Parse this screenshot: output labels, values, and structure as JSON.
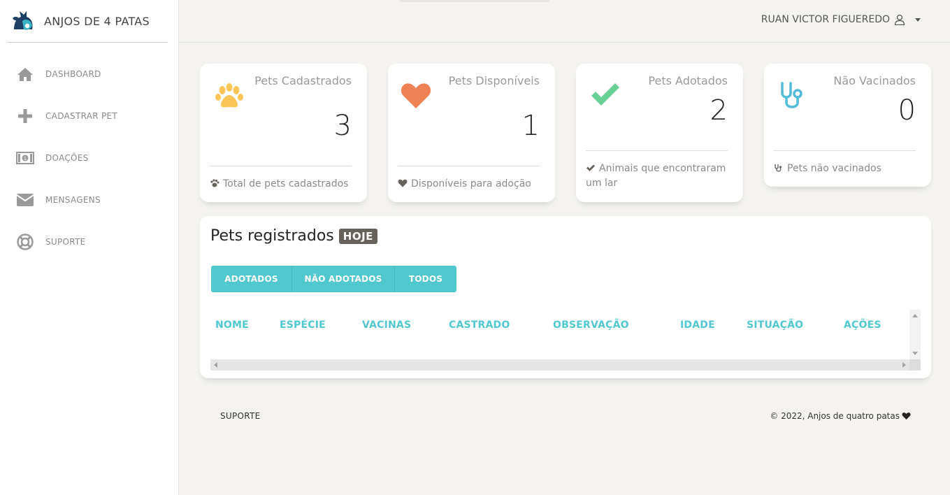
{
  "brand": {
    "name": "ANJOS DE 4 PATAS"
  },
  "sidebar": {
    "items": [
      {
        "label": "DASHBOARD",
        "icon": "home-icon"
      },
      {
        "label": "CADASTRAR PET",
        "icon": "plus-icon"
      },
      {
        "label": "DOAÇÕES",
        "icon": "money-icon"
      },
      {
        "label": "MENSAGENS",
        "icon": "envelope-icon"
      },
      {
        "label": "SUPORTE",
        "icon": "lifebuoy-icon"
      }
    ]
  },
  "header": {
    "user_name": "RUAN VICTOR FIGUEREDO"
  },
  "stats": [
    {
      "title": "Pets Cadastrados",
      "value": "3",
      "footer": "Total de pets cadastrados",
      "icon": "paw-icon",
      "color": "#fbc658"
    },
    {
      "title": "Pets Disponíveis",
      "value": "1",
      "footer": "Disponíveis para adoção",
      "icon": "heart-icon",
      "color": "#ef8157"
    },
    {
      "title": "Pets Adotados",
      "value": "2",
      "footer": "Animais que encontraram um lar",
      "icon": "check-icon",
      "color": "#6bd098"
    },
    {
      "title": "Não Vacinados",
      "value": "0",
      "footer": "Pets não vacinados",
      "icon": "stethoscope-icon",
      "color": "#51bcda"
    }
  ],
  "table": {
    "title": "Pets registrados",
    "badge": "HOJE",
    "filters": [
      "ADOTADOS",
      "NÃO ADOTADOS",
      "TODOS"
    ],
    "columns": [
      "NOME",
      "ESPÉCIE",
      "VACINAS",
      "CASTRADO",
      "OBSERVAÇÃO",
      "IDADE",
      "SITUAÇÃO",
      "AÇÕES"
    ],
    "rows": []
  },
  "footer": {
    "link": "SUPORTE",
    "copyright": "© 2022, Anjos de quatro patas"
  },
  "colors": {
    "accent": "#51c8cf",
    "badge": "#66615b",
    "background": "#f4f3ef"
  }
}
